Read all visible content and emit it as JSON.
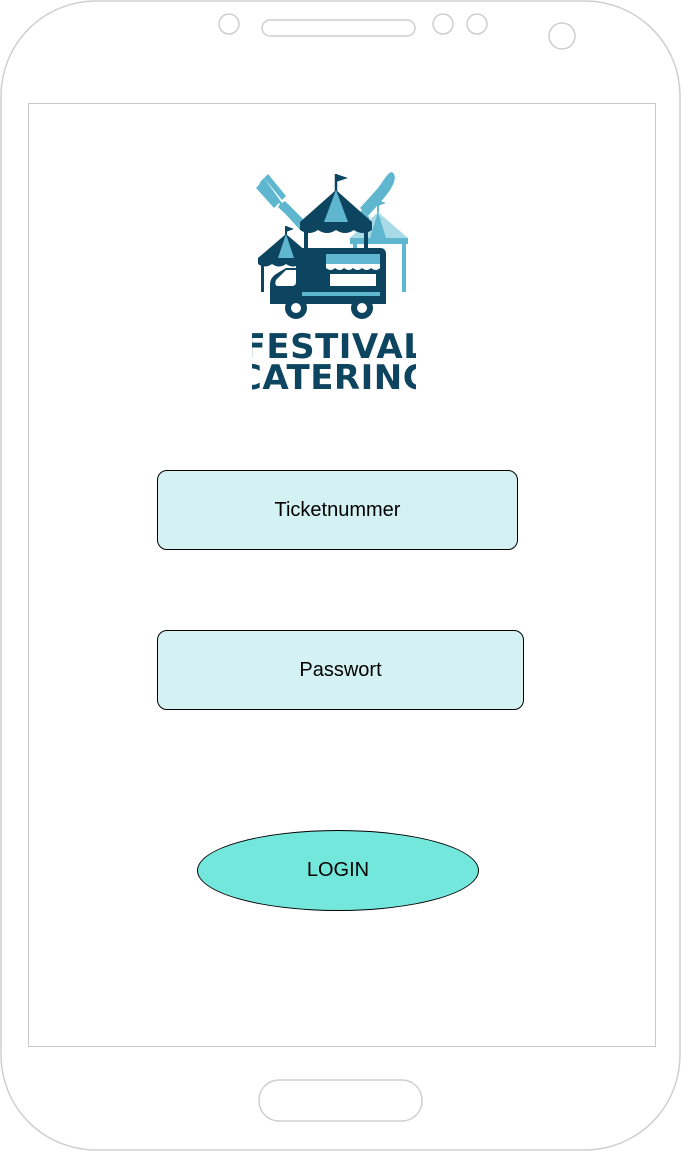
{
  "logo": {
    "line1": "FESTIVAL",
    "line2": "CATERING"
  },
  "form": {
    "ticket_placeholder": "Ticketnummer",
    "password_placeholder": "Passwort",
    "login_label": "LOGIN"
  },
  "colors": {
    "field_bg": "#d4f1f3",
    "login_bg": "#74e7dc",
    "logo_dark": "#0d4560",
    "logo_light": "#5fb7cf"
  }
}
